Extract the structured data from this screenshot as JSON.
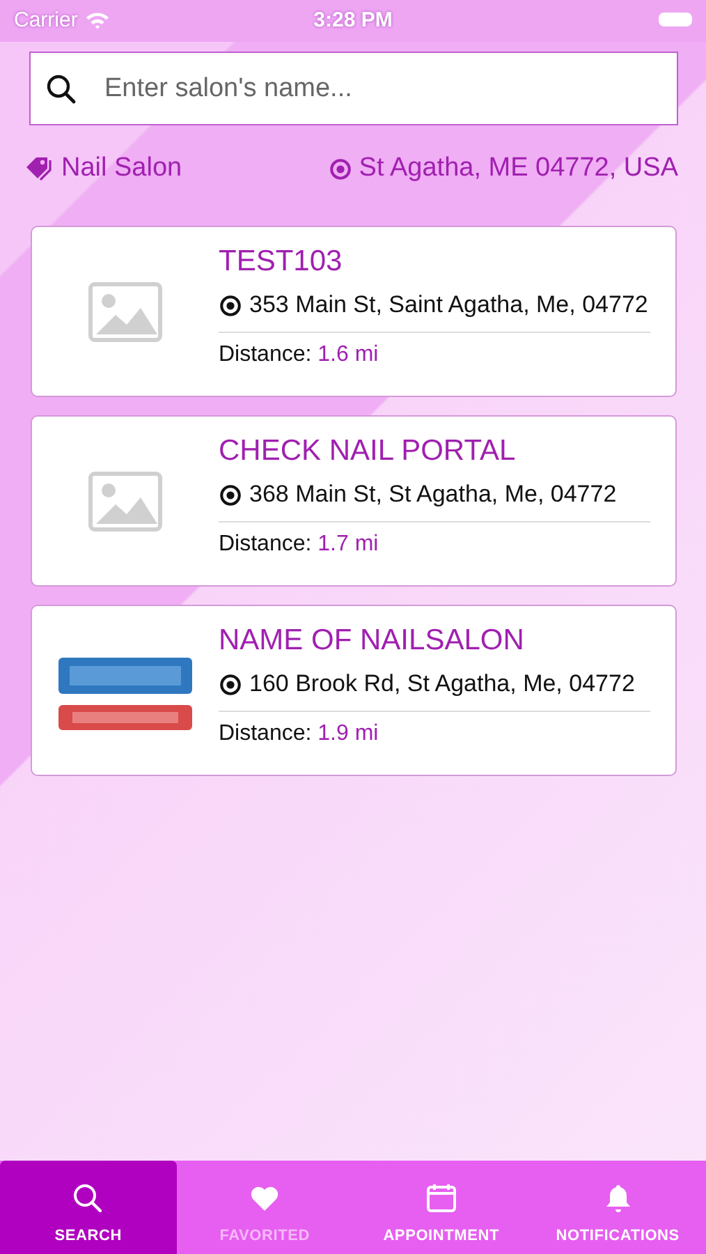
{
  "status_bar": {
    "carrier": "Carrier",
    "time": "3:28 PM"
  },
  "search": {
    "placeholder": "Enter salon's name..."
  },
  "filters": {
    "category": "Nail Salon",
    "location": "St Agatha, ME 04772, USA"
  },
  "salons": [
    {
      "name": "TEST103",
      "address": "353 Main St, Saint Agatha, Me, 04772",
      "distance_label": "Distance:",
      "distance": "1.6 mi",
      "thumbnail": {
        "kind": "placeholder"
      }
    },
    {
      "name": "CHECK NAIL PORTAL",
      "address": "368 Main St, St Agatha, Me, 04772",
      "distance_label": "Distance:",
      "distance": "1.7 mi",
      "thumbnail": {
        "kind": "placeholder"
      }
    },
    {
      "name": "NAME OF NAILSALON",
      "address": "160 Brook Rd, St Agatha, Me, 04772",
      "distance_label": "Distance:",
      "distance": "1.9 mi"
    }
  ],
  "tabs": [
    {
      "label": "SEARCH",
      "kind": "search",
      "selected": true,
      "disabled": false
    },
    {
      "label": "FAVORITED",
      "kind": "heart",
      "selected": false,
      "disabled": true
    },
    {
      "label": "APPOINTMENT",
      "kind": "calendar",
      "selected": false,
      "disabled": false
    },
    {
      "label": "NOTIFICATIONS",
      "kind": "bell",
      "selected": false,
      "disabled": false
    }
  ]
}
